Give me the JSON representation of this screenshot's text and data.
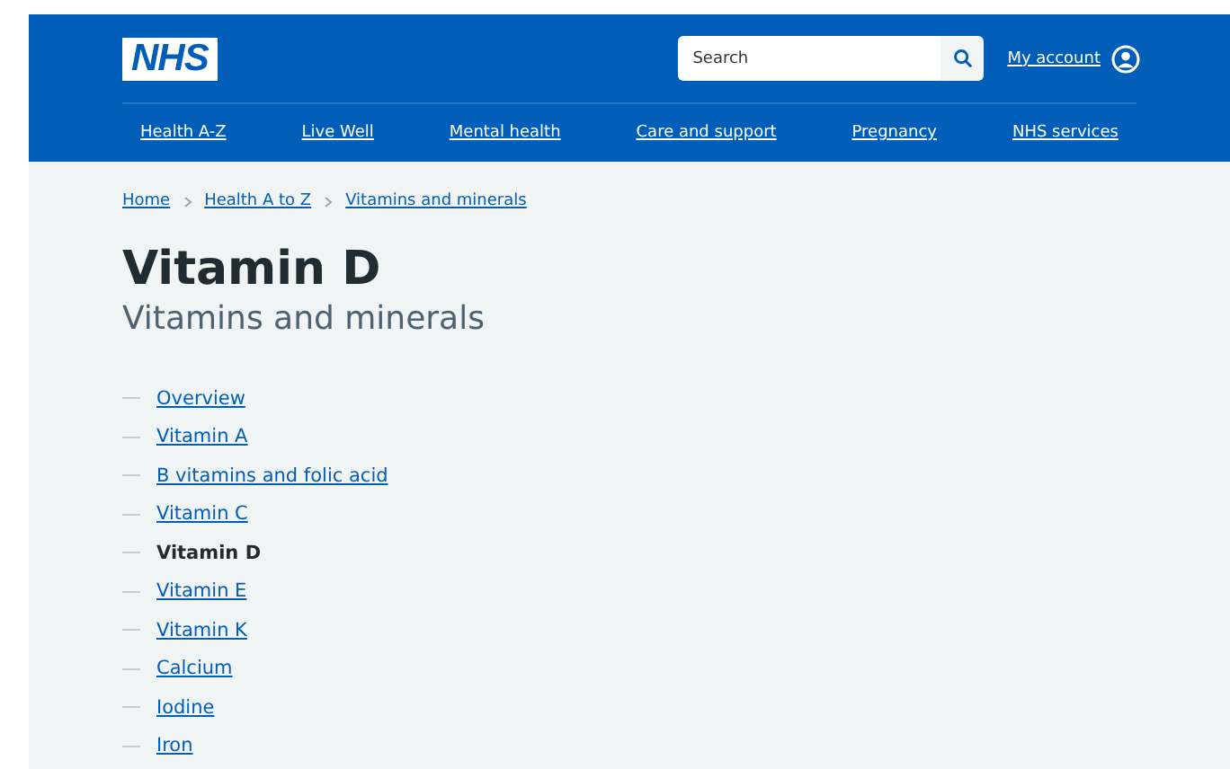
{
  "header": {
    "logo": "NHS",
    "search": {
      "placeholder": "Search"
    },
    "account_link": "My account"
  },
  "nav": [
    "Health A-Z",
    "Live Well",
    "Mental health",
    "Care and support",
    "Pregnancy",
    "NHS services"
  ],
  "breadcrumbs": [
    "Home",
    "Health A to Z",
    "Vitamins and minerals"
  ],
  "title": "Vitamin D",
  "subtitle": "Vitamins and minerals",
  "contents": [
    {
      "label": "Overview",
      "selected": false
    },
    {
      "label": "Vitamin A",
      "selected": false
    },
    {
      "label": "B vitamins and folic acid",
      "selected": false
    },
    {
      "label": "Vitamin C",
      "selected": false
    },
    {
      "label": "Vitamin D",
      "selected": true
    },
    {
      "label": "Vitamin E",
      "selected": false
    },
    {
      "label": "Vitamin K",
      "selected": false
    },
    {
      "label": "Calcium",
      "selected": false
    },
    {
      "label": "Iodine",
      "selected": false
    },
    {
      "label": "Iron",
      "selected": false
    }
  ]
}
